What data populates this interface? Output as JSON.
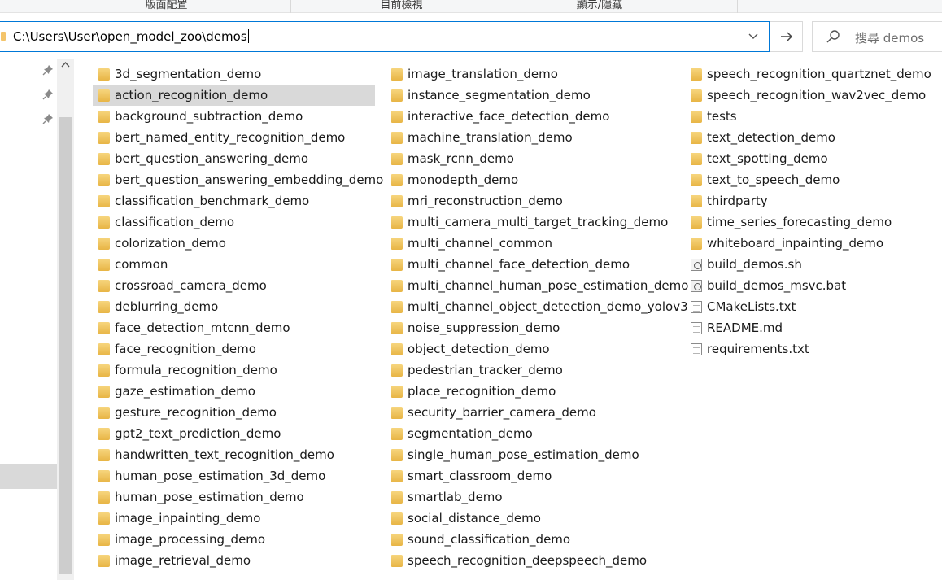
{
  "ribbon": {
    "groups": [
      "版面配置",
      "目前檢視",
      "顯示/隱藏"
    ]
  },
  "address": {
    "path": "C:\\Users\\User\\open_model_zoo\\demos"
  },
  "search": {
    "placeholder": "搜尋 demos"
  },
  "icons": {
    "folder": "folder-icon",
    "file": "text-file-icon",
    "script": "script-file-icon",
    "pin": "pin-icon",
    "search": "search-icon",
    "arrow": "arrow-right-icon",
    "dropdown": "chevron-down-icon"
  },
  "files": {
    "columns": [
      [
        {
          "name": "3d_segmentation_demo",
          "type": "folder"
        },
        {
          "name": "action_recognition_demo",
          "type": "folder",
          "selected": true
        },
        {
          "name": "background_subtraction_demo",
          "type": "folder"
        },
        {
          "name": "bert_named_entity_recognition_demo",
          "type": "folder"
        },
        {
          "name": "bert_question_answering_demo",
          "type": "folder"
        },
        {
          "name": "bert_question_answering_embedding_demo",
          "type": "folder"
        },
        {
          "name": "classification_benchmark_demo",
          "type": "folder"
        },
        {
          "name": "classification_demo",
          "type": "folder"
        },
        {
          "name": "colorization_demo",
          "type": "folder"
        },
        {
          "name": "common",
          "type": "folder"
        },
        {
          "name": "crossroad_camera_demo",
          "type": "folder"
        },
        {
          "name": "deblurring_demo",
          "type": "folder"
        },
        {
          "name": "face_detection_mtcnn_demo",
          "type": "folder"
        },
        {
          "name": "face_recognition_demo",
          "type": "folder"
        },
        {
          "name": "formula_recognition_demo",
          "type": "folder"
        },
        {
          "name": "gaze_estimation_demo",
          "type": "folder"
        },
        {
          "name": "gesture_recognition_demo",
          "type": "folder"
        },
        {
          "name": "gpt2_text_prediction_demo",
          "type": "folder"
        },
        {
          "name": "handwritten_text_recognition_demo",
          "type": "folder"
        },
        {
          "name": "human_pose_estimation_3d_demo",
          "type": "folder"
        },
        {
          "name": "human_pose_estimation_demo",
          "type": "folder"
        },
        {
          "name": "image_inpainting_demo",
          "type": "folder"
        },
        {
          "name": "image_processing_demo",
          "type": "folder"
        },
        {
          "name": "image_retrieval_demo",
          "type": "folder"
        }
      ],
      [
        {
          "name": "image_translation_demo",
          "type": "folder"
        },
        {
          "name": "instance_segmentation_demo",
          "type": "folder"
        },
        {
          "name": "interactive_face_detection_demo",
          "type": "folder"
        },
        {
          "name": "machine_translation_demo",
          "type": "folder"
        },
        {
          "name": "mask_rcnn_demo",
          "type": "folder"
        },
        {
          "name": "monodepth_demo",
          "type": "folder"
        },
        {
          "name": "mri_reconstruction_demo",
          "type": "folder"
        },
        {
          "name": "multi_camera_multi_target_tracking_demo",
          "type": "folder"
        },
        {
          "name": "multi_channel_common",
          "type": "folder"
        },
        {
          "name": "multi_channel_face_detection_demo",
          "type": "folder"
        },
        {
          "name": "multi_channel_human_pose_estimation_demo",
          "type": "folder"
        },
        {
          "name": "multi_channel_object_detection_demo_yolov3",
          "type": "folder"
        },
        {
          "name": "noise_suppression_demo",
          "type": "folder"
        },
        {
          "name": "object_detection_demo",
          "type": "folder"
        },
        {
          "name": "pedestrian_tracker_demo",
          "type": "folder"
        },
        {
          "name": "place_recognition_demo",
          "type": "folder"
        },
        {
          "name": "security_barrier_camera_demo",
          "type": "folder"
        },
        {
          "name": "segmentation_demo",
          "type": "folder"
        },
        {
          "name": "single_human_pose_estimation_demo",
          "type": "folder"
        },
        {
          "name": "smart_classroom_demo",
          "type": "folder"
        },
        {
          "name": "smartlab_demo",
          "type": "folder"
        },
        {
          "name": "social_distance_demo",
          "type": "folder"
        },
        {
          "name": "sound_classification_demo",
          "type": "folder"
        },
        {
          "name": "speech_recognition_deepspeech_demo",
          "type": "folder"
        }
      ],
      [
        {
          "name": "speech_recognition_quartznet_demo",
          "type": "folder"
        },
        {
          "name": "speech_recognition_wav2vec_demo",
          "type": "folder"
        },
        {
          "name": "tests",
          "type": "folder"
        },
        {
          "name": "text_detection_demo",
          "type": "folder"
        },
        {
          "name": "text_spotting_demo",
          "type": "folder"
        },
        {
          "name": "text_to_speech_demo",
          "type": "folder"
        },
        {
          "name": "thirdparty",
          "type": "folder"
        },
        {
          "name": "time_series_forecasting_demo",
          "type": "folder"
        },
        {
          "name": "whiteboard_inpainting_demo",
          "type": "folder"
        },
        {
          "name": "build_demos.sh",
          "type": "script"
        },
        {
          "name": "build_demos_msvc.bat",
          "type": "script"
        },
        {
          "name": "CMakeLists.txt",
          "type": "file"
        },
        {
          "name": "README.md",
          "type": "file"
        },
        {
          "name": "requirements.txt",
          "type": "file"
        }
      ]
    ]
  }
}
